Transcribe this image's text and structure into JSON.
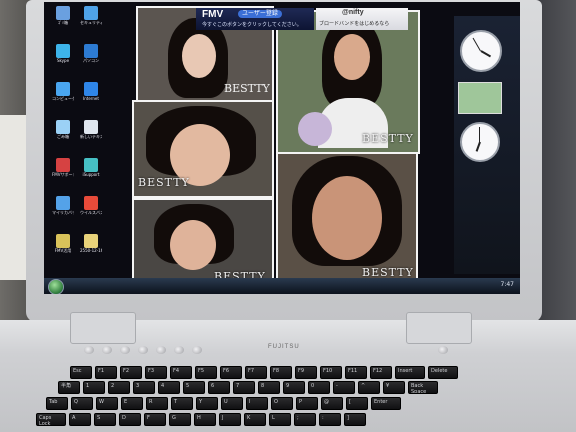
{
  "screen": {
    "fmv_logo": "FMV",
    "fmv_button": "ユーザー登録",
    "fmv_sub": "今すぐこのボタンをクリックしてください。",
    "nifty_logo": "@nifty",
    "nifty_sub": "ブロードバンドをはじめるなら",
    "tray_time": "7:47"
  },
  "desktop_icons": [
    {
      "label": "ｺﾞﾐ箱",
      "color": "#6aa0e0"
    },
    {
      "label": "セキュリティ",
      "color": "#4fa3e8"
    },
    {
      "label": "Skype",
      "color": "#3db4ea"
    },
    {
      "label": "パソコン",
      "color": "#2d7bd2"
    },
    {
      "label": "コンピュータ",
      "color": "#4aa6f0"
    },
    {
      "label": "Internet",
      "color": "#2f86e8"
    },
    {
      "label": "ごみ箱",
      "color": "#9bd1f6"
    },
    {
      "label": "新しいテキスト",
      "color": "#dfe6ee"
    },
    {
      "label": "FMVサポート",
      "color": "#d64242"
    },
    {
      "label": "iSupport",
      "color": "#46c0c4"
    },
    {
      "label": "マイリカバリ",
      "color": "#54a2e8"
    },
    {
      "label": "ウイルスバスター",
      "color": "#e84b3a"
    },
    {
      "label": "FMV活用",
      "color": "#d9c25a"
    },
    {
      "label": "2550-12-16",
      "color": "#e8d27a"
    }
  ],
  "photos": [
    {
      "brand": ""
    },
    {
      "brand": "BESTTY"
    },
    {
      "brand": "BESTTY"
    },
    {
      "brand": "BESTTY"
    },
    {
      "brand": "BESTTY"
    },
    {
      "brand": "BESTTY"
    }
  ],
  "laptop": {
    "brand": "FUJITSU",
    "keys_row1": [
      "Esc",
      "F1",
      "F2",
      "F3",
      "F4",
      "F5",
      "F6",
      "F7",
      "F8",
      "F9",
      "F10",
      "F11",
      "F12",
      "Insert",
      "Delete"
    ],
    "keys_row2": [
      "半角",
      "1",
      "2",
      "3",
      "4",
      "5",
      "6",
      "7",
      "8",
      "9",
      "0",
      "-",
      "^",
      "¥",
      "Back Space"
    ],
    "keys_row3": [
      "Tab",
      "Q",
      "W",
      "E",
      "R",
      "T",
      "Y",
      "U",
      "I",
      "O",
      "P",
      "@",
      "[",
      "Enter"
    ],
    "keys_row4": [
      "Caps Lock",
      "A",
      "S",
      "D",
      "F",
      "G",
      "H",
      "J",
      "K",
      "L",
      ";",
      ":",
      "]"
    ]
  },
  "colors": {
    "fmv_bar": "#1a2350",
    "sidebar": "#141b28",
    "taskbar": "#1a2636",
    "laptop_body": "#d3d4d7"
  }
}
